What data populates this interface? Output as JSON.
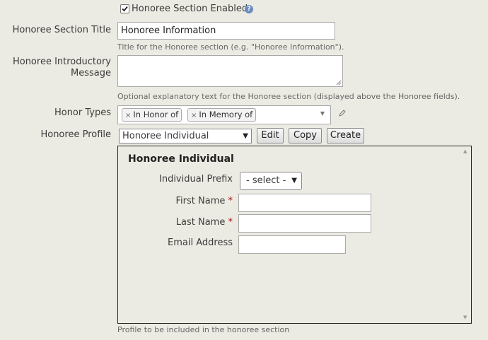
{
  "enabled": {
    "label": "Honoree Section Enabled",
    "checked": true,
    "help_icon": "question-circle-icon"
  },
  "title_field": {
    "label": "Honoree Section Title",
    "value": "Honoree Information",
    "help": "Title for the Honoree section (e.g. \"Honoree Information\")."
  },
  "intro_field": {
    "label_line1": "Honoree Introductory",
    "label_line2": "Message",
    "value": "",
    "help": "Optional explanatory text for the Honoree section (displayed above the Honoree fields)."
  },
  "honor_types": {
    "label": "Honor Types",
    "chips": [
      "In Honor of",
      "In Memory of"
    ],
    "remove_icon": "×",
    "dropdown_icon": "▼",
    "edit_icon": "pencil-icon"
  },
  "profile": {
    "label": "Honoree Profile",
    "selected": "Honoree Individual",
    "edit_label": "Edit",
    "copy_label": "Copy",
    "create_label": "Create",
    "help": "Profile to be included in the honoree section"
  },
  "preview": {
    "heading": "Honoree Individual",
    "prefix_label": "Individual Prefix",
    "prefix_value": "- select -",
    "first_name_label": "First Name",
    "last_name_label": "Last Name",
    "email_label": "Email Address",
    "required_mark": "*"
  }
}
